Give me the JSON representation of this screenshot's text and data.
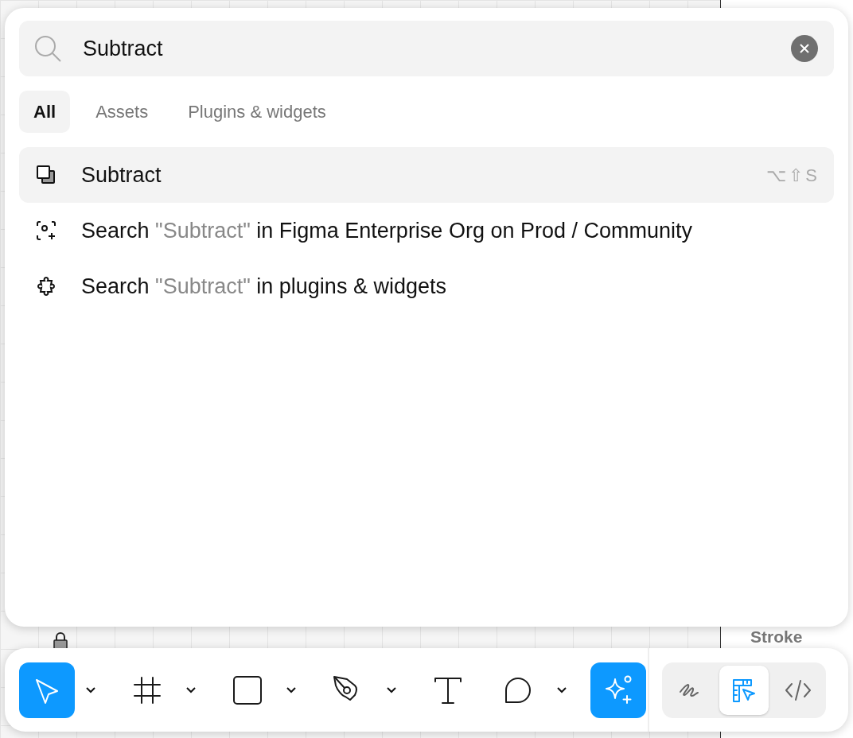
{
  "canvas": {
    "side_label": "Stroke"
  },
  "search": {
    "value": "Subtract"
  },
  "tabs": [
    {
      "label": "All",
      "selected": true
    },
    {
      "label": "Assets",
      "selected": false
    },
    {
      "label": "Plugins & widgets",
      "selected": false
    }
  ],
  "results": [
    {
      "kind": "command",
      "selected": true,
      "label": "Subtract",
      "shortcut": "⌥⇧S"
    },
    {
      "kind": "community",
      "selected": false,
      "prefix": "Search ",
      "query": "\"Subtract\"",
      "suffix": " in Figma Enterprise Org on Prod / Community"
    },
    {
      "kind": "plugins",
      "selected": false,
      "prefix": "Search ",
      "query": "\"Subtract\"",
      "suffix": " in plugins & widgets"
    }
  ],
  "toolbar": {
    "tools": [
      {
        "kind": "move",
        "selected": true,
        "dropdown": true
      },
      {
        "kind": "frame",
        "selected": false,
        "dropdown": true
      },
      {
        "kind": "rectangle",
        "selected": false,
        "dropdown": true
      },
      {
        "kind": "pen",
        "selected": false,
        "dropdown": true
      },
      {
        "kind": "text",
        "selected": false,
        "dropdown": false
      },
      {
        "kind": "comment",
        "selected": false,
        "dropdown": true
      },
      {
        "kind": "ai",
        "selected": true,
        "dropdown": false
      }
    ],
    "modes": [
      {
        "kind": "draw",
        "selected": false
      },
      {
        "kind": "design",
        "selected": true
      },
      {
        "kind": "dev",
        "selected": false
      }
    ]
  }
}
